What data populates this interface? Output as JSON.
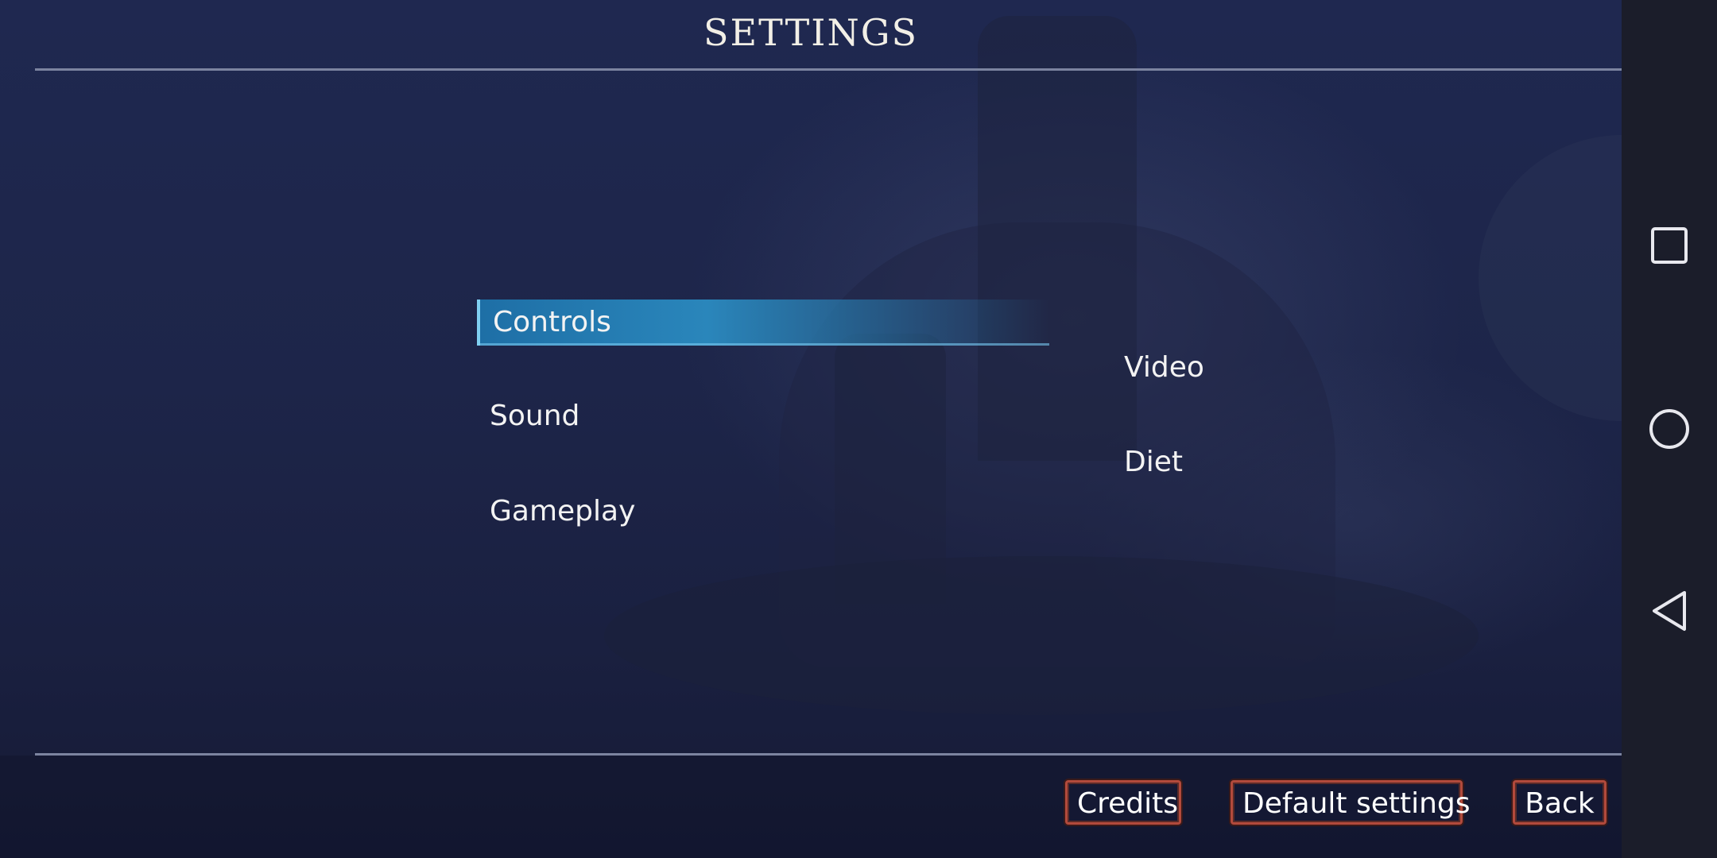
{
  "screen": {
    "title": "SETTINGS"
  },
  "menu": {
    "left": [
      {
        "label": "Controls",
        "selected": true
      },
      {
        "label": "Sound",
        "selected": false
      },
      {
        "label": "Gameplay",
        "selected": false
      }
    ],
    "right": [
      {
        "label": "Video",
        "selected": false
      },
      {
        "label": "Diet",
        "selected": false
      }
    ]
  },
  "buttons": {
    "credits": "Credits",
    "default_settings": "Default settings",
    "back": "Back"
  },
  "android_nav": {
    "recent_icon": "square-icon",
    "home_icon": "circle-icon",
    "back_icon": "triangle-back-icon"
  },
  "colors": {
    "selection": "#2a86bb",
    "button_border": "#b24a3c",
    "text": "#f3f3f3"
  }
}
